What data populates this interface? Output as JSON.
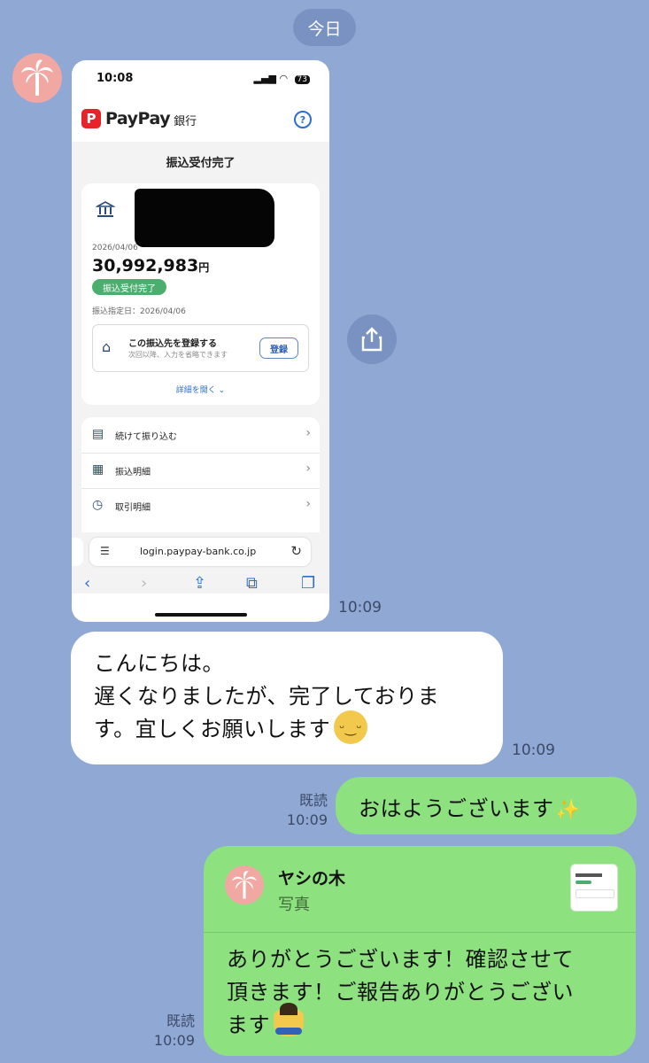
{
  "date_label": "今日",
  "screenshot": {
    "status_time": "10:08",
    "battery": "73",
    "brand_logo_letter": "P",
    "brand_name": "PayPay",
    "brand_suffix": "銀行",
    "page_title": "振込受付完了",
    "transfer_date": "2026/04/06",
    "amount": "30,992,983",
    "amount_unit": "円",
    "status_badge": "振込受付完了",
    "scheduled_date": "振込指定日：2026/04/06",
    "register_title": "この振込先を登録する",
    "register_sub": "次回以降、入力を省略できます",
    "register_button": "登録",
    "details_link": "詳細を開く",
    "menu": [
      {
        "label": "続けて振り込む"
      },
      {
        "label": "振込明細"
      },
      {
        "label": "取引明細"
      }
    ],
    "url": "login.paypay-bank.co.jp"
  },
  "screenshot_time": "10:09",
  "received_message": {
    "line1": "こんにちは。",
    "line2": "遅くなりましたが、完了しておりま",
    "line3": "す。宜しくお願いします",
    "time": "10:09"
  },
  "sent_message_1": {
    "text": "おはようございます",
    "read_label": "既読",
    "time": "10:09"
  },
  "sent_message_2": {
    "quote_name": "ヤシの木",
    "quote_type": "写真",
    "line1": "ありがとうございます！確認させて",
    "line2": "頂きます！ご報告ありがとうござい",
    "line3": "ます",
    "read_label": "既読",
    "time": "10:09"
  },
  "colors": {
    "background": "#8fa8d4",
    "sent_bubble": "#8de27f",
    "avatar": "#f1a7a2",
    "paypay_red": "#e8222a"
  }
}
